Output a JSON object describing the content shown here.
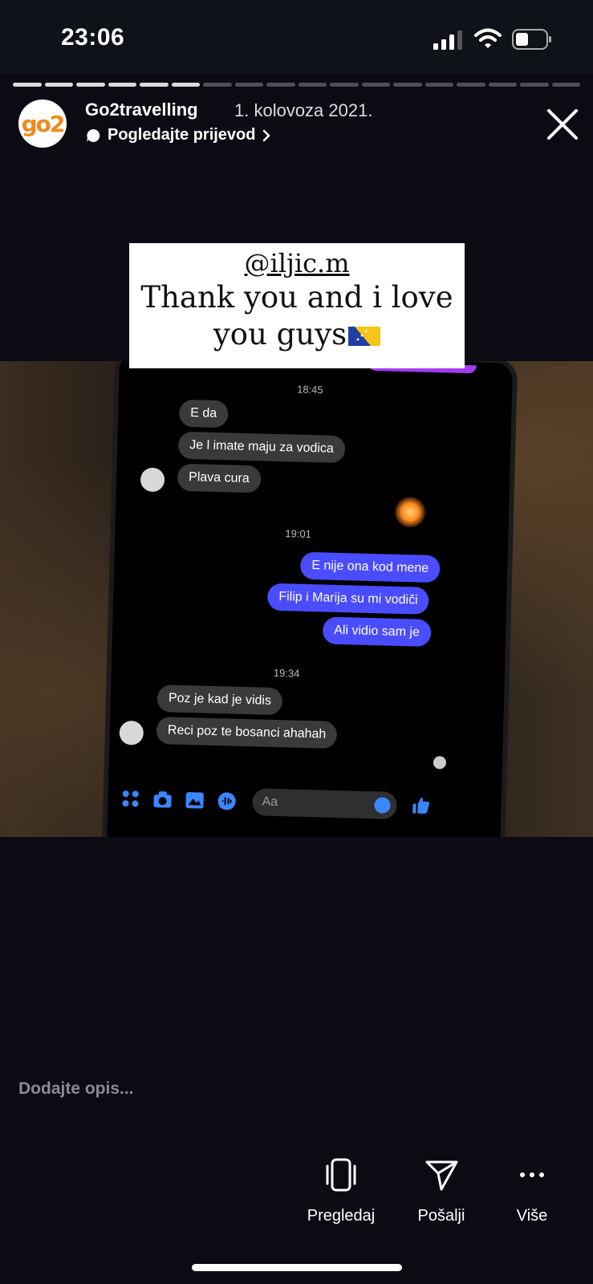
{
  "status_bar": {
    "time": "23:06"
  },
  "story": {
    "progress_segments": 18,
    "progress_completed": 6,
    "avatar_text": "go2",
    "username": "Go2travelling",
    "date": "1. kolovoza 2021.",
    "translate_label": "Pogledajte prijevod"
  },
  "sticker": {
    "handle": "@iljic.m",
    "line1": "Thank you and i love",
    "line2": "you guys"
  },
  "chat": {
    "time1": "18:45",
    "in1": [
      "E da",
      "Je l imate maju za vodica",
      "Plava cura"
    ],
    "time2": "19:01",
    "out": [
      "E nije ona kod mene",
      "Filip i Marija su mi vodiči",
      "Ali vidio sam je"
    ],
    "time3": "19:34",
    "in2": [
      "Poz je kad je vidis",
      "Reci poz te bosanci ahahah"
    ],
    "compose_placeholder": "Aa"
  },
  "caption_placeholder": "Dodajte opis...",
  "actions": {
    "preview": "Pregledaj",
    "send": "Pošalji",
    "more": "Više"
  }
}
